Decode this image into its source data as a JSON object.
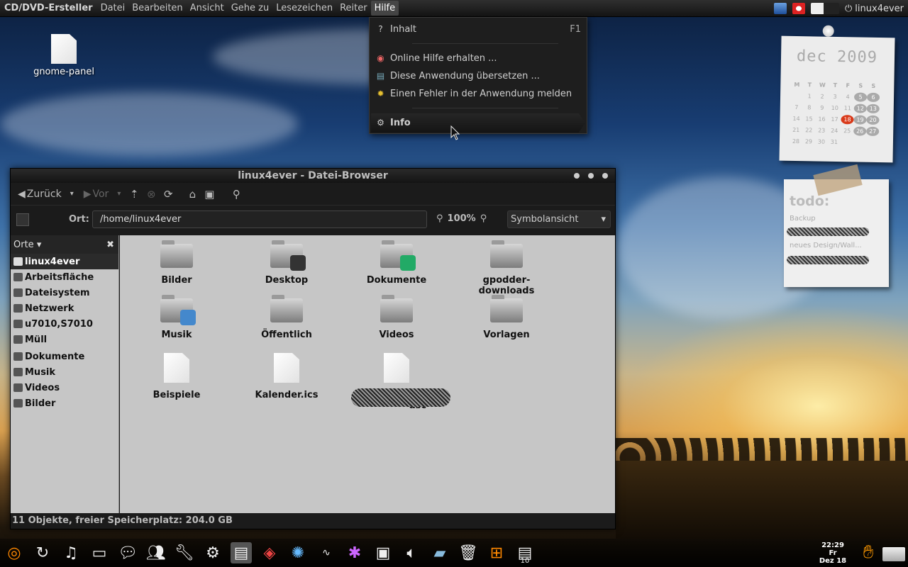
{
  "topbar": {
    "app_title": "CD/DVD-Ersteller",
    "menus": [
      "Datei",
      "Bearbeiten",
      "Ansicht",
      "Gehe zu",
      "Lesezeichen",
      "Reiter",
      "Hilfe"
    ],
    "user": "linux4ever"
  },
  "help_menu": {
    "items": [
      {
        "label": "Inhalt",
        "accel": "F1",
        "icon": "help-icon"
      },
      {
        "label": "Online Hilfe erhalten ...",
        "icon": "lifebuoy-icon"
      },
      {
        "label": "Diese Anwendung übersetzen ...",
        "icon": "translate-icon"
      },
      {
        "label": "Einen Fehler in der Anwendung melden",
        "icon": "bug-icon"
      },
      {
        "label": "Info",
        "icon": "gear-icon"
      }
    ]
  },
  "desktop": {
    "icon_label": "gnome-panel"
  },
  "calendar": {
    "month": "dec",
    "year": "2009",
    "weekdays": [
      "M",
      "T",
      "W",
      "T",
      "F",
      "S",
      "S"
    ],
    "weeks": [
      [
        "",
        "1",
        "2",
        "3",
        "4",
        "5",
        "6"
      ],
      [
        "7",
        "8",
        "9",
        "10",
        "11",
        "12",
        "13"
      ],
      [
        "14",
        "15",
        "16",
        "17",
        "18",
        "19",
        "20"
      ],
      [
        "21",
        "22",
        "23",
        "24",
        "25",
        "26",
        "27"
      ],
      [
        "28",
        "29",
        "30",
        "31",
        "",
        "",
        ""
      ]
    ],
    "today": "18"
  },
  "todo": {
    "title": "todo:",
    "items": [
      "Backup",
      "neues Design/Wall..."
    ]
  },
  "window": {
    "title": "linux4ever - Datei-Browser",
    "toolbar": {
      "back": "Zurück",
      "forward": "Vor"
    },
    "location_label": "Ort:",
    "location_value": "/home/linux4ever",
    "zoom": "100%",
    "view": "Symbolansicht",
    "sidebar_title": "Orte",
    "places": [
      "linux4ever",
      "Arbeitsfläche",
      "Dateisystem",
      "Netzwerk",
      "u7010,S7010",
      "Müll",
      "Dokumente",
      "Musik",
      "Videos",
      "Bilder"
    ],
    "files": [
      {
        "name": "Bilder",
        "kind": "folder"
      },
      {
        "name": "Desktop",
        "kind": "folder"
      },
      {
        "name": "Dokumente",
        "kind": "folder"
      },
      {
        "name": "gpodder-downloads",
        "kind": "folder"
      },
      {
        "name": "Musik",
        "kind": "folder"
      },
      {
        "name": "Öffentlich",
        "kind": "folder"
      },
      {
        "name": "Videos",
        "kind": "folder"
      },
      {
        "name": "Vorlagen",
        "kind": "folder"
      },
      {
        "name": "Beispiele",
        "kind": "file"
      },
      {
        "name": "Kalender.ics",
        "kind": "file"
      },
      {
        "name": "rev.\nasc",
        "kind": "file"
      }
    ],
    "status": "11 Objekte, freier Speicherplatz: 204.0 GB"
  },
  "dock": {
    "clock_time": "22:29",
    "clock_day": "Fr",
    "clock_date": "Dez 18",
    "badge": "10"
  }
}
